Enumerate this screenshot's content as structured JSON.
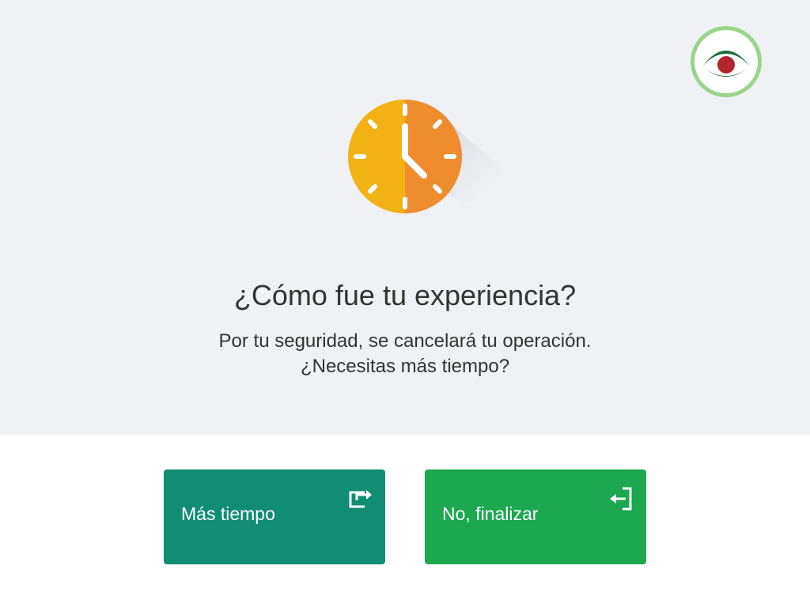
{
  "header": {
    "logo_icon": "bank-eye-logo-icon"
  },
  "dialog": {
    "icon": "clock-icon",
    "title": "¿Cómo fue tu experiencia?",
    "message_line1": "Por tu seguridad, se cancelará tu operación.",
    "message_line2": "¿Necesitas más tiempo?"
  },
  "actions": {
    "more_time_label": "Más tiempo",
    "more_time_icon": "share-arrow-icon",
    "finish_label": "No, finalizar",
    "finish_icon": "exit-arrow-icon"
  },
  "colors": {
    "background_top": "#f0f1f5",
    "more_time_button": "#118d74",
    "finish_button": "#1ba84f",
    "clock_left": "#f2b214",
    "clock_right": "#ef8c2e"
  }
}
